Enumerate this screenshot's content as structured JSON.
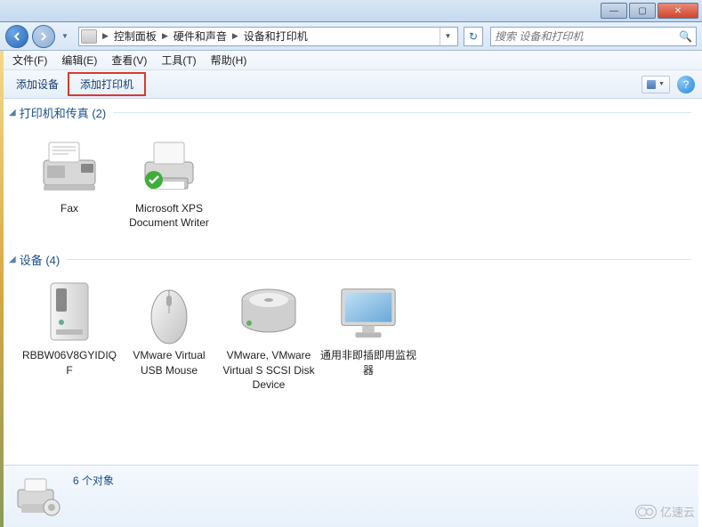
{
  "titlebar": {
    "min": "—",
    "max": "▢",
    "close": "✕"
  },
  "nav": {
    "crumbs": [
      "控制面板",
      "硬件和声音",
      "设备和打印机"
    ],
    "refresh_glyph": "↻"
  },
  "search": {
    "placeholder": "搜索 设备和打印机",
    "icon": "🔍"
  },
  "menu": {
    "file": "文件(F)",
    "edit": "编辑(E)",
    "view": "查看(V)",
    "tools": "工具(T)",
    "help": "帮助(H)"
  },
  "toolbar": {
    "add_device": "添加设备",
    "add_printer": "添加打印机",
    "help_glyph": "?"
  },
  "groups": {
    "printers": {
      "title": "打印机和传真 (2)"
    },
    "devices": {
      "title": "设备 (4)"
    }
  },
  "printers": [
    {
      "label": "Fax",
      "icon": "fax"
    },
    {
      "label": "Microsoft XPS Document Writer",
      "icon": "printer",
      "default": true
    }
  ],
  "devices": [
    {
      "label": "RBBW06V8GYIDIQF",
      "icon": "computer"
    },
    {
      "label": "VMware Virtual USB Mouse",
      "icon": "mouse"
    },
    {
      "label": "VMware, VMware Virtual S SCSI Disk Device",
      "icon": "disk"
    },
    {
      "label": "通用非即插即用监视器",
      "icon": "monitor"
    }
  ],
  "status": {
    "count_text": "6 个对象"
  },
  "watermark": {
    "text": "亿速云"
  }
}
